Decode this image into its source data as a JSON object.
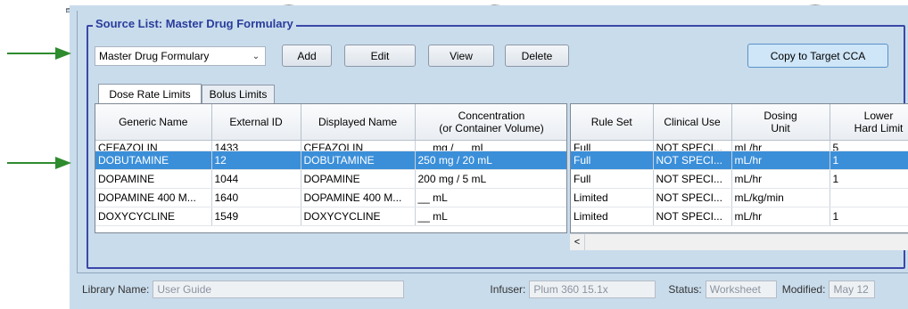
{
  "source_list": {
    "title": "Source List: Master Drug Formulary",
    "formulary_select": "Master Drug Formulary",
    "buttons": {
      "add": "Add",
      "edit": "Edit",
      "view": "View",
      "delete": "Delete",
      "copy": "Copy to Target CCA"
    }
  },
  "tabs": {
    "dose_rate": "Dose Rate Limits",
    "bolus": "Bolus Limits"
  },
  "left_table": {
    "headers": [
      "Generic Name",
      "External ID",
      "Displayed Name",
      "Concentration\n(or Container Volume)"
    ],
    "rows": [
      [
        "CEFAZOLIN",
        "1433",
        "CEFAZOLIN",
        "__ mg / __ mL"
      ],
      [
        "DOBUTAMINE",
        "12",
        "DOBUTAMINE",
        "250 mg / 20 mL"
      ],
      [
        "DOPAMINE",
        "1044",
        "DOPAMINE",
        "200 mg / 5 mL"
      ],
      [
        "DOPAMINE 400 M...",
        "1640",
        "DOPAMINE 400 M...",
        "__ mL"
      ],
      [
        "DOXYCYCLINE",
        "1549",
        "DOXYCYCLINE",
        "__ mL"
      ]
    ]
  },
  "right_table": {
    "headers": [
      "Rule Set",
      "Clinical Use",
      "Dosing\nUnit",
      "Lower\nHard Limit"
    ],
    "rows": [
      [
        "Full",
        "NOT SPECI...",
        "mL/hr",
        "5"
      ],
      [
        "Full",
        "NOT SPECI...",
        "mL/hr",
        "1"
      ],
      [
        "Full",
        "NOT SPECI...",
        "mL/hr",
        "1"
      ],
      [
        "Limited",
        "NOT SPECI...",
        "mL/kg/min",
        ""
      ],
      [
        "Limited",
        "NOT SPECI...",
        "mL/hr",
        "1"
      ]
    ]
  },
  "selected_row": 1,
  "scroll_left": "<",
  "status": {
    "library_label": "Library Name:",
    "library_value": "User Guide",
    "infuser_label": "Infuser:",
    "infuser_value": "Plum 360 15.1x",
    "status_label": "Status:",
    "status_value": "Worksheet",
    "modified_label": "Modified:",
    "modified_value": "May 12"
  },
  "colors": {
    "accent": "#3a47a8",
    "selection": "#3b8fd9",
    "window_bg": "#c9dcec",
    "arrow": "#2e8b2e"
  },
  "icons": {
    "dropdown": "chevron-down-icon",
    "pointer_arrows": "arrow-right-icon"
  }
}
